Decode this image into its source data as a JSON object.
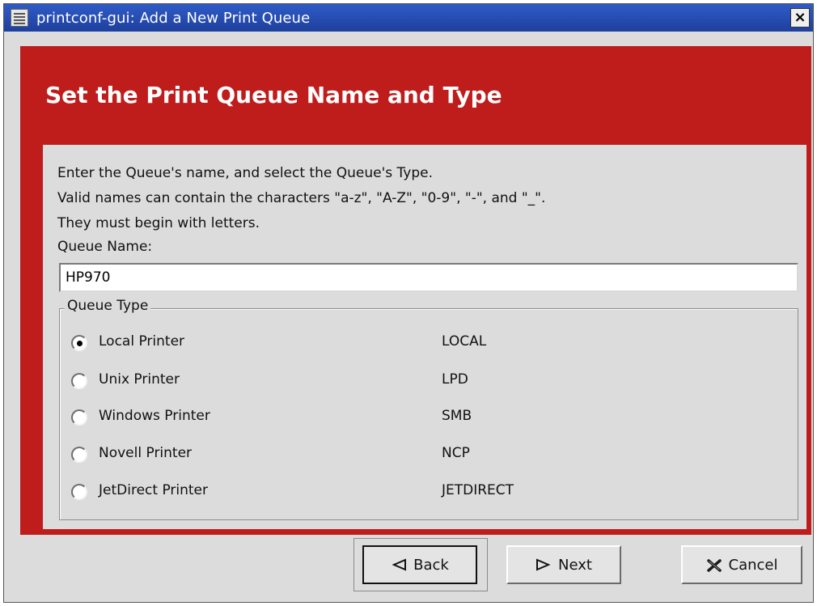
{
  "window": {
    "title": "printconf-gui: Add a New Print Queue"
  },
  "header": {
    "title": "Set the Print Queue Name and Type"
  },
  "description": [
    "Enter the Queue's name, and select the Queue's Type.",
    "Valid names can contain the characters \"a-z\", \"A-Z\", \"0-9\", \"-\", and \"_\".",
    "They must begin with letters."
  ],
  "queue_name": {
    "label": "Queue Name:",
    "value": "HP970"
  },
  "queue_type": {
    "title": "Queue Type",
    "selected": "Local Printer",
    "options": [
      {
        "label": "Local Printer",
        "type": "LOCAL",
        "checked": true
      },
      {
        "label": "Unix Printer",
        "type": "LPD",
        "checked": false
      },
      {
        "label": "Windows Printer",
        "type": "SMB",
        "checked": false
      },
      {
        "label": "Novell Printer",
        "type": "NCP",
        "checked": false
      },
      {
        "label": "JetDirect Printer",
        "type": "JETDIRECT",
        "checked": false
      }
    ]
  },
  "buttons": {
    "back": "Back",
    "next": "Next",
    "cancel": "Cancel"
  },
  "icons": {
    "window_menu": "window-menu-icon",
    "close": "close-icon",
    "back": "back-arrow-icon",
    "next": "next-arrow-icon",
    "cancel": "cancel-x-icon"
  },
  "colors": {
    "title_bar": "#2f5cc7",
    "banner": "#bf1c1c",
    "panel": "#dcdcdc",
    "cancel_icon": "#1b1b1b"
  }
}
